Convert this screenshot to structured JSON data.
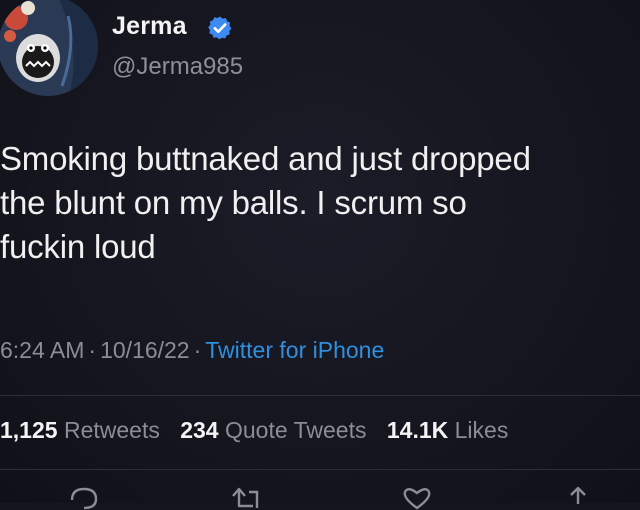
{
  "tweet": {
    "author": {
      "name": "Jerma",
      "handle": "@Jerma985",
      "verified_icon": "verified-badge-icon",
      "avatar_icon": "avatar-cartoon-face"
    },
    "text": "Smoking buttnaked and just dropped\nthe blunt on my balls. I scrum so\nfuckin loud",
    "meta": {
      "time": "6:24 AM",
      "separator": "·",
      "date": "10/16/22",
      "source": "Twitter for iPhone"
    },
    "stats": {
      "retweets_count": "1,125",
      "retweets_label": "Retweets",
      "quote_tweets_count": "234",
      "quote_tweets_label": "Quote Tweets",
      "likes_count": "14.1K",
      "likes_label": "Likes"
    },
    "actions": [
      "reply-icon",
      "retweet-icon",
      "like-icon",
      "share-icon"
    ]
  },
  "colors": {
    "background": "#15151f",
    "text": "#f0f0f0",
    "secondary_text": "#8a8c96",
    "link": "#2f8fe0",
    "verified": "#3d8bf2"
  }
}
